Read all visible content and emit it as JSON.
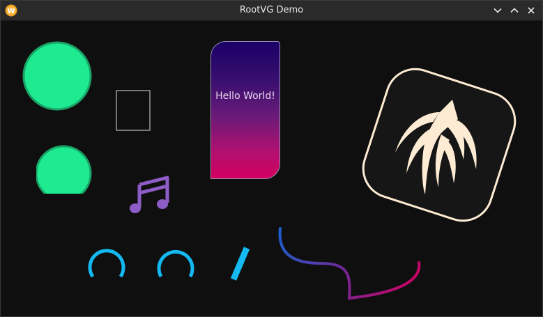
{
  "window": {
    "title": "RootVG Demo",
    "app_icon": "w-logo-icon",
    "controls": [
      "chevron-down-icon",
      "chevron-up-icon",
      "close-icon"
    ]
  },
  "canvas": {
    "hello_box": {
      "text": "Hello World!"
    }
  },
  "colors": {
    "titlebar": "#2a2a2a",
    "background": "#0f0f10",
    "green": "#1eea92",
    "green_stroke": "#1aa566",
    "cyan": "#13b9f0",
    "purple": "#8d5cc6",
    "logo_fill": "#fdebd3",
    "logo_bg": "#161616",
    "gradient_top": "#1b0066",
    "gradient_bottom": "#d4005f"
  }
}
